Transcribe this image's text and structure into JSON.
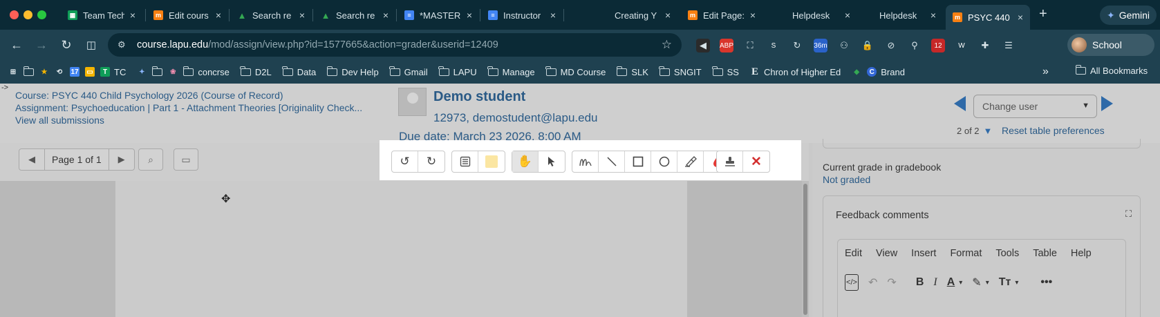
{
  "browser": {
    "tabs": [
      {
        "label": "Team Tech",
        "icon": "sheets-icon",
        "color": "#0f9d58",
        "active": false
      },
      {
        "label": "Edit cours",
        "icon": "moodle-icon",
        "color": "#f98012",
        "active": false
      },
      {
        "label": "Search re",
        "icon": "drive-icon",
        "color": "#34a853",
        "active": false
      },
      {
        "label": "Search re",
        "icon": "drive-icon",
        "color": "#34a853",
        "active": false
      },
      {
        "label": "*MASTER",
        "icon": "docs-icon",
        "color": "#4285f4",
        "active": false
      },
      {
        "label": "Instructor",
        "icon": "docs-icon",
        "color": "#4285f4",
        "active": false
      },
      {
        "label": "Creating Y",
        "icon": "page-icon",
        "color": "#3e6a7a",
        "active": false
      },
      {
        "label": "Edit Page:",
        "icon": "moodle-icon",
        "color": "#f98012",
        "active": false
      },
      {
        "label": "Helpdesk",
        "icon": "page-icon",
        "color": "#3e6a7a",
        "active": false
      },
      {
        "label": "Helpdesk",
        "icon": "page-icon",
        "color": "#3e6a7a",
        "active": false
      },
      {
        "label": "PSYC 440",
        "icon": "moodle-icon",
        "color": "#f98012",
        "active": true
      }
    ],
    "new_tab": "+",
    "gemini_label": "Gemini",
    "url_host": "course.lapu.edu",
    "url_path": "/mod/assign/view.php?id=1577665&action=grader&userid=12409",
    "profile_label": "School",
    "extensions": [
      {
        "icon": "arrow-left-circle-icon",
        "text": "",
        "color": "#2b2b2b"
      },
      {
        "icon": "adblock-icon",
        "text": "ABP",
        "color": "#d9362b"
      },
      {
        "icon": "screenshot-icon",
        "text": "",
        "color": "#1f4150"
      },
      {
        "icon": "s-extension-icon",
        "text": "S",
        "color": "#1f4150"
      },
      {
        "icon": "refresh-green-icon",
        "text": "",
        "color": "#1f4150"
      },
      {
        "icon": "timer-icon",
        "text": "36m",
        "color": "#2a62c9"
      },
      {
        "icon": "people-icon",
        "text": "",
        "color": "#1f4150"
      },
      {
        "icon": "lock-icon",
        "text": "",
        "color": "#1f4150"
      },
      {
        "icon": "block-icon",
        "text": "",
        "color": "#1f4150"
      },
      {
        "icon": "walk-icon",
        "text": "",
        "color": "#1f4150"
      },
      {
        "icon": "badge-icon",
        "text": "12",
        "color": "#c62828"
      },
      {
        "icon": "w-extension-icon",
        "text": "W",
        "color": "#1f4150"
      },
      {
        "icon": "puzzle-icon",
        "text": "",
        "color": "#1f4150"
      },
      {
        "icon": "reading-icon",
        "text": "",
        "color": "#1f4150"
      }
    ],
    "bookmarks": [
      {
        "label": "",
        "icon": "apps-grid-icon"
      },
      {
        "label": "",
        "icon": "folder-icon"
      },
      {
        "label": "",
        "icon": "star-icon"
      },
      {
        "label": "",
        "icon": "history-icon"
      },
      {
        "label": "",
        "icon": "calendar-icon"
      },
      {
        "label": "",
        "icon": "slides-icon"
      },
      {
        "label": "TC",
        "icon": "sheets-icon"
      },
      {
        "label": "",
        "icon": "gemini-star-icon"
      },
      {
        "label": "",
        "icon": "folder-icon"
      },
      {
        "label": "",
        "icon": "brain-icon"
      },
      {
        "label": "concrse",
        "icon": "folder-icon"
      },
      {
        "label": "D2L",
        "icon": "folder-icon"
      },
      {
        "label": "Data",
        "icon": "folder-icon"
      },
      {
        "label": "Dev Help",
        "icon": "folder-icon"
      },
      {
        "label": "Gmail",
        "icon": "folder-icon"
      },
      {
        "label": "LAPU",
        "icon": "folder-icon"
      },
      {
        "label": "Manage",
        "icon": "folder-icon"
      },
      {
        "label": "MD Course",
        "icon": "folder-icon"
      },
      {
        "label": "SLK",
        "icon": "folder-icon"
      },
      {
        "label": "SNGIT",
        "icon": "folder-icon"
      },
      {
        "label": "SS",
        "icon": "folder-icon"
      },
      {
        "label": "Chron of Higher Ed",
        "icon": "chronicle-icon"
      },
      {
        "label": "",
        "icon": "drive-icon"
      },
      {
        "label": "Brand",
        "icon": "brand-c-icon"
      }
    ],
    "more_bookmarks": "»",
    "all_bookmarks": "All Bookmarks"
  },
  "page": {
    "course_link": "Course: PSYC 440 Child Psychology 2026 (Course of Record)",
    "assignment_link": "Assignment: Psychoeducation | Part 1 - Attachment Theories [Originality Check...",
    "view_all": "View all submissions",
    "student_name": "Demo student",
    "student_id_email": "12973, demostudent@lapu.edu",
    "due_date": "Due date: March 23 2026, 8:00 AM",
    "change_user_placeholder": "Change user",
    "user_count": "2 of 2",
    "reset_prefs": "Reset table preferences",
    "page_indicator": "Page 1 of 1",
    "grade_label": "Current grade in gradebook",
    "grade_value": "Not graded",
    "feedback_title": "Feedback comments",
    "editor_menu": [
      "Edit",
      "View",
      "Insert",
      "Format",
      "Tools",
      "Table",
      "Help"
    ]
  },
  "annotation_toolbar": {
    "groups": [
      [
        "undo-icon",
        "redo-icon"
      ],
      [
        "comment-icon",
        "comment-color-swatch-icon"
      ],
      [
        "pan-hand-icon",
        "select-arrow-icon"
      ],
      [
        "pen-icon",
        "line-icon",
        "rectangle-icon",
        "oval-icon",
        "highlighter-icon",
        "color-drop-icon"
      ],
      [
        "stamp-icon",
        "delete-x-icon"
      ]
    ],
    "colors": {
      "swatch": "#fbe6a2",
      "drop": "#e53935",
      "delete": "#d32f2f"
    }
  }
}
